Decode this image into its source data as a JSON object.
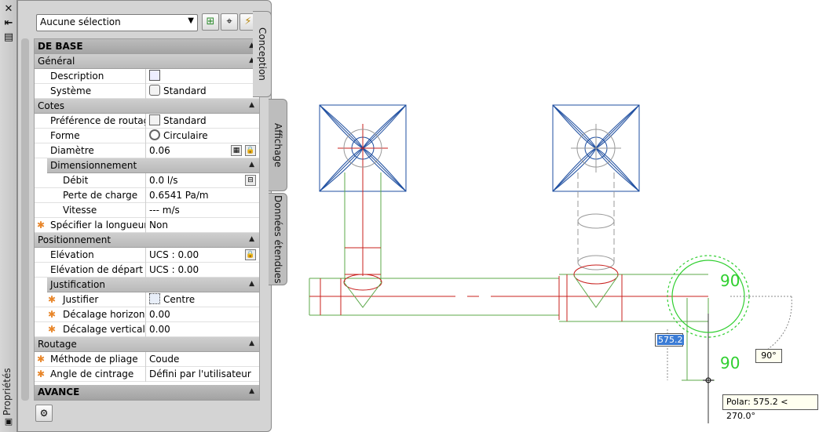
{
  "palette": {
    "title": "Propriétés",
    "selection": "Aucune sélection",
    "tabs": [
      "Conception",
      "Affichage",
      "Données étendues"
    ],
    "categories": {
      "base": "DE BASE",
      "general": "Général",
      "cotes": "Cotes",
      "dimensionnement": "Dimensionnement",
      "positionnement": "Positionnement",
      "justification": "Justification",
      "routage": "Routage",
      "avance": "AVANCE"
    },
    "properties": [
      {
        "name": "Description",
        "value": "",
        "icon": "description-icon"
      },
      {
        "name": "Système",
        "value": "Standard",
        "icon": "system-icon"
      },
      {
        "name": "Préférence de routage",
        "value": "Standard",
        "icon": "routing-icon"
      },
      {
        "name": "Forme",
        "value": "Circulaire",
        "icon": "circle-shape-icon"
      },
      {
        "name": "Diamètre",
        "value": "0.06",
        "icon": ""
      },
      {
        "name": "Débit",
        "value": "0.0 l/s",
        "icon": ""
      },
      {
        "name": "Perte de charge",
        "value": "0.6541 Pa/m",
        "icon": ""
      },
      {
        "name": "Vitesse",
        "value": "--- m/s",
        "icon": ""
      },
      {
        "name": "Spécifier la longueur...",
        "value": "Non",
        "icon": ""
      },
      {
        "name": "Elévation",
        "value": "UCS : 0.00",
        "icon": ""
      },
      {
        "name": "Elévation de départ",
        "value": "UCS : 0.00",
        "icon": ""
      },
      {
        "name": "Justifier",
        "value": "Centre",
        "icon": "justify-icon"
      },
      {
        "name": "Décalage horizon...",
        "value": "0.00",
        "icon": ""
      },
      {
        "name": "Décalage vertical",
        "value": "0.00",
        "icon": ""
      },
      {
        "name": "Méthode de pliage",
        "value": "Coude",
        "icon": ""
      },
      {
        "name": "Angle de cintrage",
        "value": "Défini par l'utilisateur",
        "icon": ""
      }
    ]
  },
  "drawing": {
    "dyn_input_value": "575.2",
    "angle_label": "90°",
    "polar_tooltip": "Polar: 575.2 < 270.0°",
    "compass_label_top": "90",
    "compass_label_bottom": "90"
  },
  "colors": {
    "pipe_green": "#5ca84a",
    "pipe_red": "#c8201e",
    "diffuser_blue": "#1f4fa0",
    "compass_green": "#2fcf2f"
  }
}
